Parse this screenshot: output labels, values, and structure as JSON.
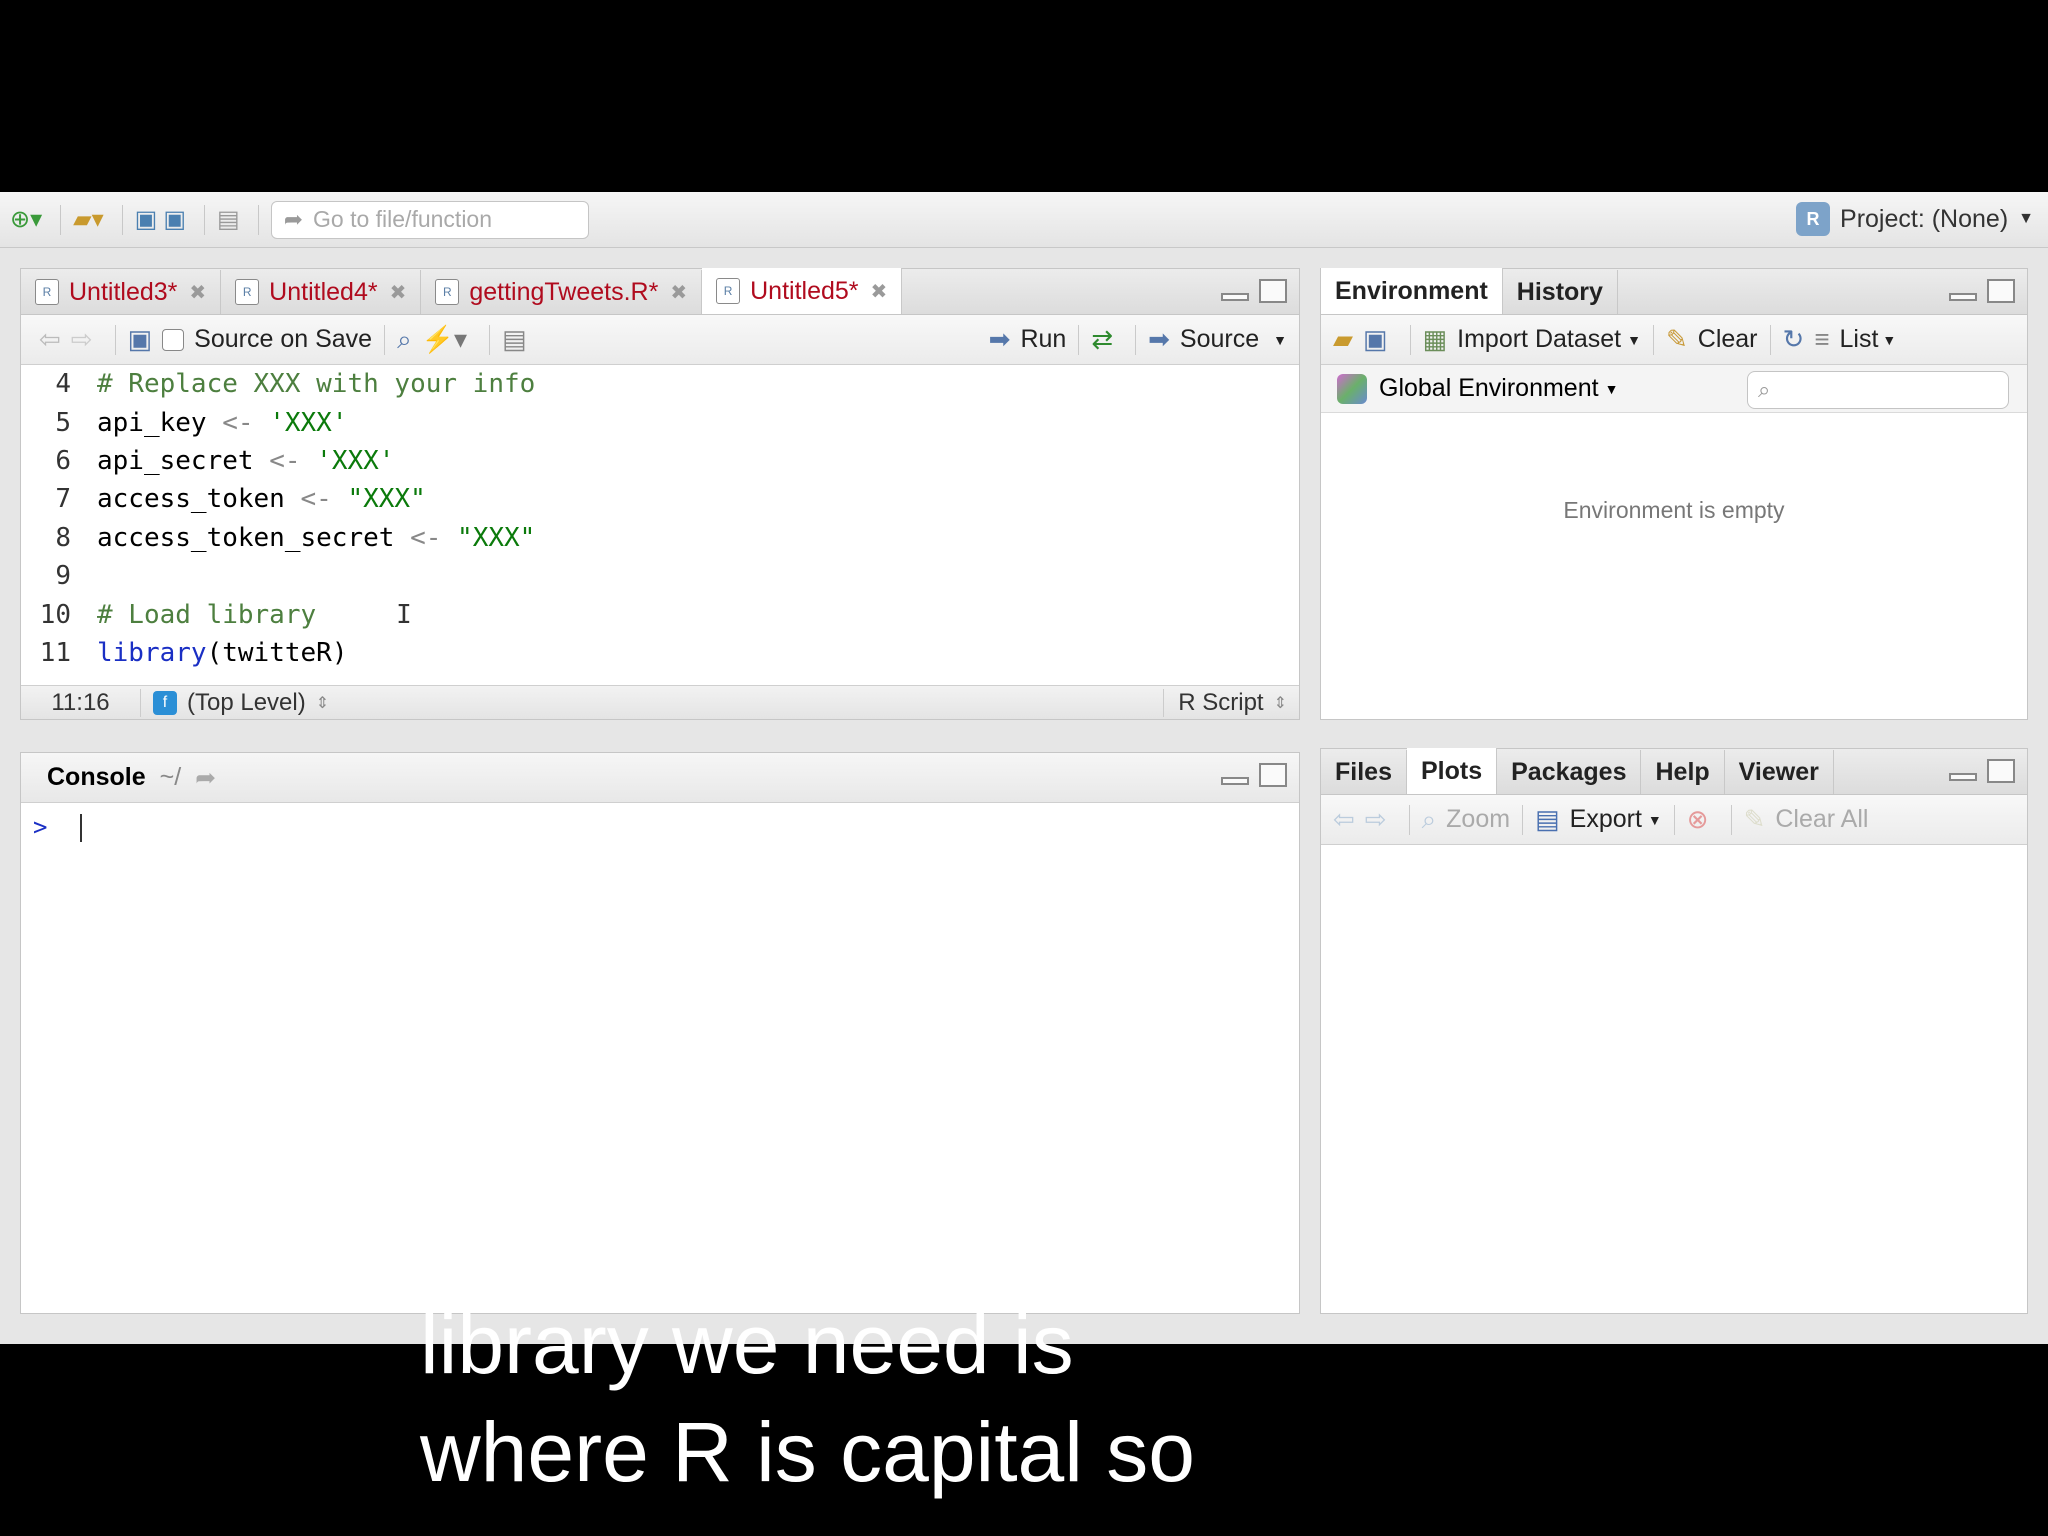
{
  "toolbar": {
    "goto_placeholder": "Go to file/function",
    "project_label": "Project: (None)"
  },
  "editor": {
    "tabs": [
      {
        "label": "Untitled3*"
      },
      {
        "label": "Untitled4*"
      },
      {
        "label": "gettingTweets.R*"
      },
      {
        "label": "Untitled5*"
      }
    ],
    "source_on_save": "Source on Save",
    "run_label": "Run",
    "source_label": "Source",
    "code_lines": [
      {
        "num": "4",
        "text": "# Replace XXX with your info"
      },
      {
        "num": "5",
        "var": "api_key",
        "value": "'XXX'"
      },
      {
        "num": "6",
        "var": "api_secret",
        "value": "'XXX'"
      },
      {
        "num": "7",
        "var": "access_token",
        "value": "\"XXX\""
      },
      {
        "num": "8",
        "var": "access_token_secret",
        "value": "\"XXX\""
      },
      {
        "num": "9"
      },
      {
        "num": "10",
        "text": "# Load library"
      },
      {
        "num": "11",
        "fn": "library",
        "arg": "twitteR"
      }
    ],
    "assign_op": "<-",
    "status_position": "11:16",
    "status_scope": "(Top Level)",
    "status_type": "R Script"
  },
  "console": {
    "title": "Console",
    "path": "~/",
    "prompt": ">"
  },
  "environment": {
    "tabs": [
      "Environment",
      "History"
    ],
    "import_dataset": "Import Dataset",
    "clear_label": "Clear",
    "list_label": "List",
    "scope": "Global Environment",
    "empty_message": "Environment is empty"
  },
  "files": {
    "tabs": [
      "Files",
      "Plots",
      "Packages",
      "Help",
      "Viewer"
    ],
    "zoom_label": "Zoom",
    "export_label": "Export",
    "clear_all_label": "Clear All"
  },
  "caption": {
    "line1": "library we need is",
    "line2": "where R is capital so"
  }
}
